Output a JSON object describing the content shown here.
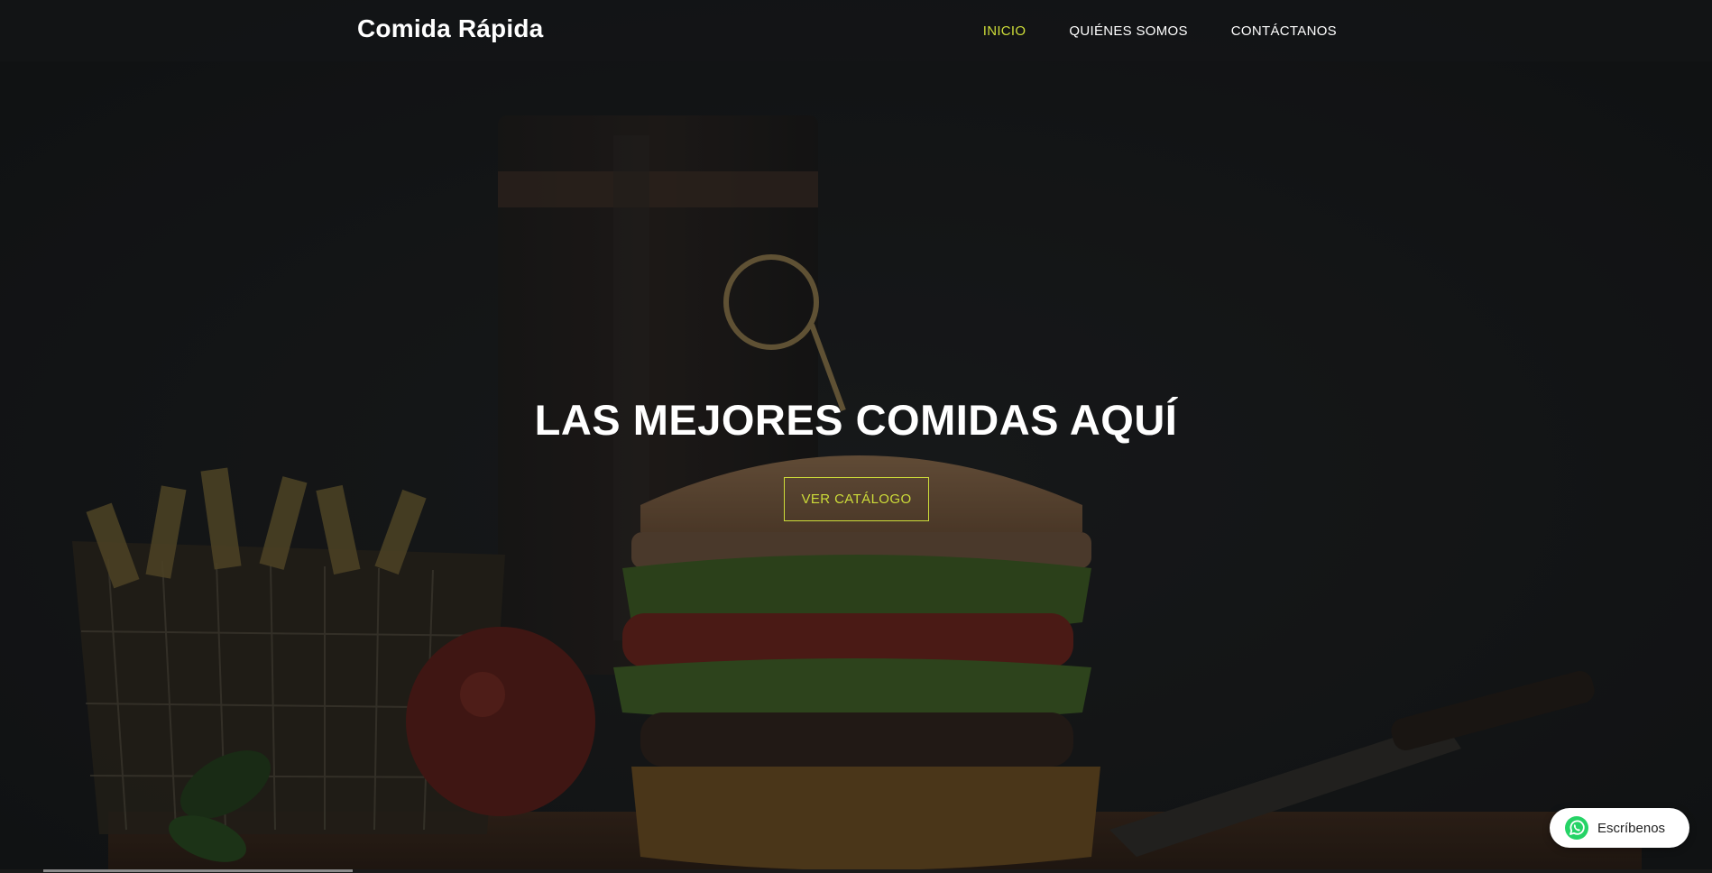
{
  "brand": {
    "name": "Comida Rápida"
  },
  "nav": {
    "items": [
      {
        "label": "INICIO",
        "active": true
      },
      {
        "label": "QUIÉNES SOMOS",
        "active": false
      },
      {
        "label": "CONTÁCTANOS",
        "active": false
      }
    ]
  },
  "hero": {
    "title": "LAS MEJORES COMIDAS AQUÍ",
    "cta_label": "VER CATÁLOGO"
  },
  "whatsapp": {
    "label": "Escríbenos",
    "icon": "whatsapp-icon"
  },
  "colors": {
    "accent": "#cddc39",
    "background": "#141517",
    "text": "#ffffff",
    "whatsapp_green": "#25d366"
  }
}
